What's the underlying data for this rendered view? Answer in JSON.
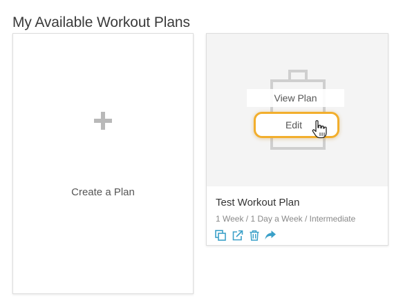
{
  "page": {
    "title": "My Available Workout Plans"
  },
  "create_card": {
    "label": "Create a Plan",
    "icon": "plus-icon"
  },
  "plan_card": {
    "overlay": {
      "view_label": "View Plan",
      "edit_label": "Edit"
    },
    "title": "Test Workout Plan",
    "meta": "1 Week / 1 Day a Week / Intermediate",
    "actions": [
      {
        "icon": "copy-icon"
      },
      {
        "icon": "external-link-icon"
      },
      {
        "icon": "trash-icon"
      },
      {
        "icon": "share-icon"
      }
    ]
  },
  "colors": {
    "accent_highlight": "#f2ae2c",
    "action_icon": "#3aa0c8",
    "placeholder_icon": "#c9c9c9"
  }
}
